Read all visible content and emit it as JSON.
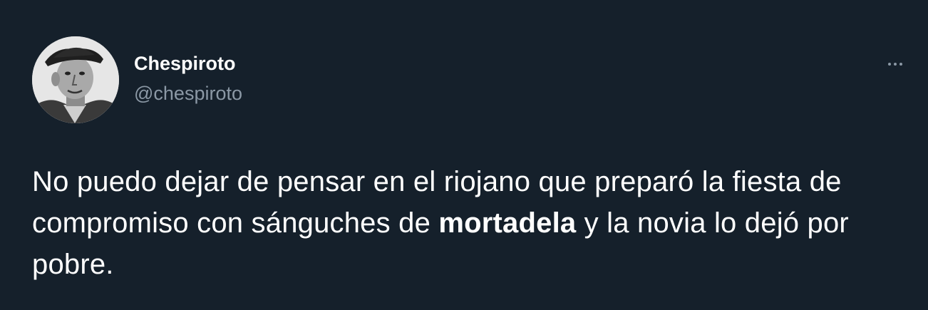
{
  "tweet": {
    "display_name": "Chespiroto",
    "handle": "@chespiroto",
    "text_before": "No puedo dejar de pensar en el riojano que preparó la fiesta de compromiso con sánguches de ",
    "text_bold": "mortadela",
    "text_after": " y la novia lo dejó por pobre.",
    "more_icon": "more-horizontal-icon"
  },
  "colors": {
    "background": "#15202b",
    "text_primary": "#ffffff",
    "text_secondary": "#8b98a5"
  }
}
